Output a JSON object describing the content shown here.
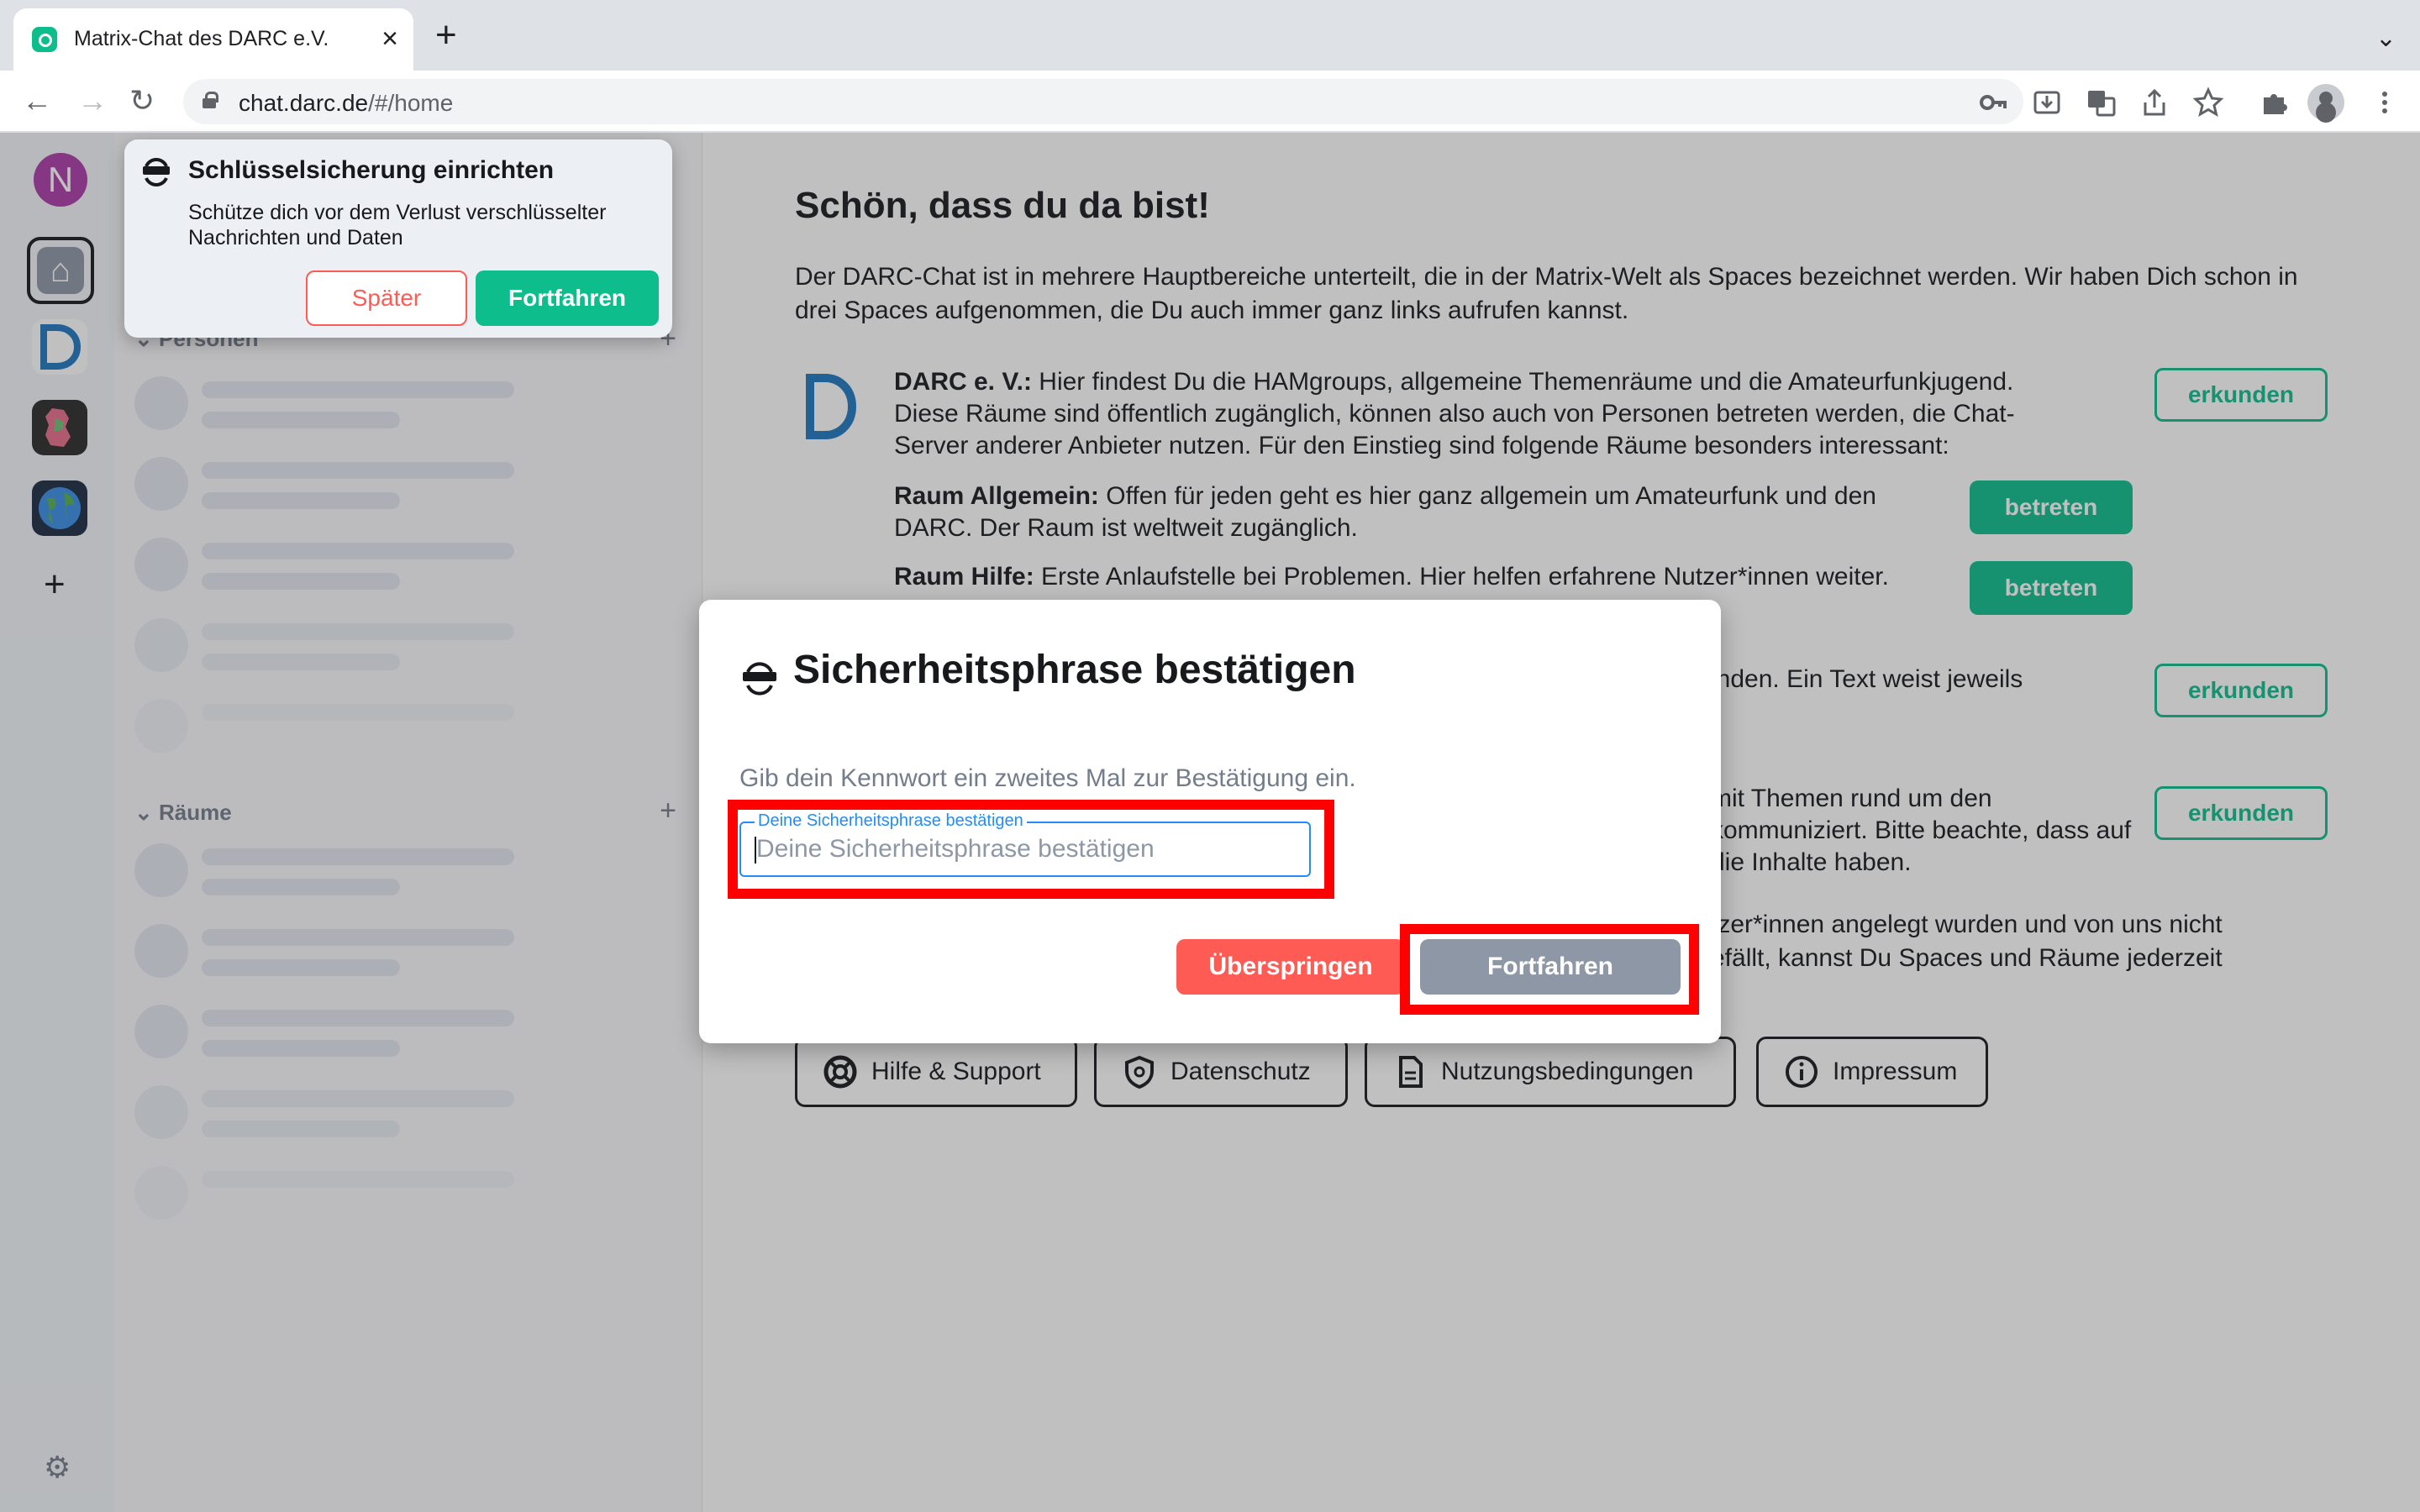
{
  "browser": {
    "tab_title": "Matrix-Chat des DARC e.V.",
    "tab_close": "×",
    "new_tab": "+",
    "tab_menu": "⌄",
    "url_domain": "chat.darc.de",
    "url_path": "/#/home",
    "nav": {
      "back": "←",
      "forward": "→",
      "reload": "↻"
    },
    "icons": [
      "key-icon",
      "download-icon",
      "translate-icon",
      "share-icon",
      "star-icon",
      "extensions-icon",
      "profile-icon",
      "menu-icon"
    ]
  },
  "spaces": {
    "user_initial": "N",
    "user_color": "#ac3ba8",
    "add": "+",
    "settings": "⚙"
  },
  "roomlist": {
    "people_header": "Personen",
    "rooms_header": "Räume",
    "add": "+"
  },
  "welcome": {
    "title": "Schön, dass du da bist!",
    "intro": "Der DARC-Chat ist in mehrere Hauptbereiche unterteilt, die in der Matrix-Welt als Spaces bezeichnet werden. Wir haben Dich schon in drei Spaces aufgenommen, die Du auch immer ganz links aufrufen kannst.",
    "darc_name": "DARC e. V.:",
    "darc_text": " Hier findest Du die HAMgroups, allgemeine Themenräume und die Amateurfunkjugend. Diese Räume sind öffentlich zugänglich, können also auch von Personen betreten werden, die Chat-Server anderer Anbieter nutzen. Für den Einstieg sind folgende Räume besonders interessant:",
    "room1_name": "Raum Allgemein:",
    "room1_text": " Offen für jeden geht es hier ganz allgemein um Amateurfunk und den DARC. Der Raum ist weltweit zugänglich.",
    "room2_name": "Raum Hilfe:",
    "room2_text": " Erste Anlaufstelle bei Problemen. Hier helfen erfahrene Nutzer*innen weiter.",
    "block2_text": "inden. Ein Text weist jeweils",
    "block3_text": "mit Themen rund um den kommuniziert. Bitte beachte, dass auf die Inhalte haben.",
    "block4_line1": "tzer*innen angelegt wurden und von uns nicht",
    "block4_line2": "efällt, kannst Du Spaces und Räume jederzeit",
    "explore": "erkunden",
    "join": "betreten",
    "footer": {
      "help": "Hilfe & Support",
      "privacy": "Datenschutz",
      "terms": "Nutzungsbedingungen",
      "imprint": "Impressum"
    }
  },
  "toast": {
    "title": "Schlüsselsicherung einrichten",
    "body": "Schütze dich vor dem Verlust verschlüsselter Nachrichten und Daten",
    "later": "Später",
    "continue": "Fortfahren"
  },
  "dialog": {
    "title": "Sicherheitsphrase bestätigen",
    "description": "Gib dein Kennwort ein zweites Mal zur Bestätigung ein.",
    "field_label": "Deine Sicherheitsphrase bestätigen",
    "field_placeholder": "Deine Sicherheitsphrase bestätigen",
    "field_value": "",
    "skip": "Überspringen",
    "continue": "Fortfahren"
  },
  "colors": {
    "accent": "#0dbd8b",
    "alert": "#ff5b55",
    "disabled": "#8d97a5",
    "highlight": "#ff0000"
  }
}
